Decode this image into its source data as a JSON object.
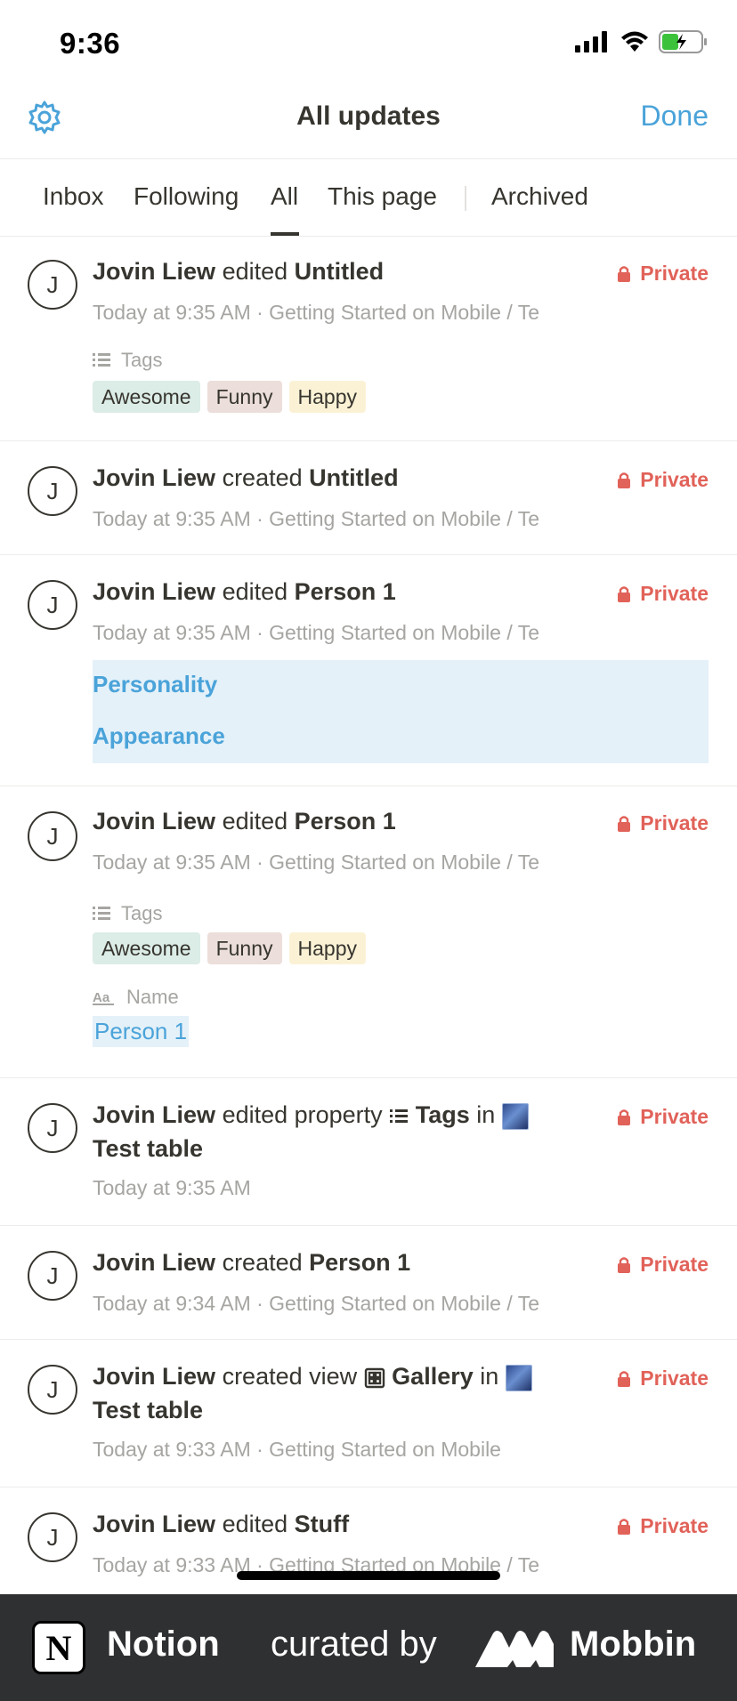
{
  "status_bar": {
    "time": "9:36"
  },
  "header": {
    "title": "All updates",
    "done_label": "Done"
  },
  "tabs": [
    {
      "label": "Inbox"
    },
    {
      "label": "Following"
    },
    {
      "label": "All"
    },
    {
      "label": "This page"
    },
    {
      "label": "Archived"
    }
  ],
  "privacy_label": "Private",
  "avatar_initial": "J",
  "items": [
    {
      "user": "Jovin Liew",
      "action": "edited",
      "target": "Untitled",
      "meta": "Today at 9:35 AM · Getting Started on Mobile / Te",
      "tags_label": "Tags",
      "tags": [
        "Awesome",
        "Funny",
        "Happy"
      ]
    },
    {
      "user": "Jovin Liew",
      "action": "created",
      "target": "Untitled",
      "meta": "Today at 9:35 AM · Getting Started on Mobile / Te"
    },
    {
      "user": "Jovin Liew",
      "action": "edited",
      "target": "Person 1",
      "meta": "Today at 9:35 AM · Getting Started on Mobile / Te",
      "highlights": [
        "Personality",
        "Appearance"
      ]
    },
    {
      "user": "Jovin Liew",
      "action": "edited",
      "target": "Person 1",
      "meta": "Today at 9:35 AM · Getting Started on Mobile / Te",
      "tags_label": "Tags",
      "tags": [
        "Awesome",
        "Funny",
        "Happy"
      ],
      "name_label": "Name",
      "name_value": "Person 1"
    },
    {
      "user": "Jovin Liew",
      "action": "edited property",
      "property": "Tags",
      "connector": "in",
      "table": "Test table",
      "meta": "Today at 9:35 AM"
    },
    {
      "user": "Jovin Liew",
      "action": "created",
      "target": "Person 1",
      "meta": "Today at 9:34 AM · Getting Started on Mobile / Te"
    },
    {
      "user": "Jovin Liew",
      "action": "created view",
      "view": "Gallery",
      "connector": "in",
      "table": "Test table",
      "meta": "Today at 9:33 AM · Getting Started on Mobile"
    },
    {
      "user": "Jovin Liew",
      "action": "edited",
      "target": "Stuff",
      "meta": "Today at 9:33 AM · Getting Started on Mobile / Te"
    }
  ],
  "banner": {
    "app_name": "Notion",
    "curated_by": "curated by",
    "brand": "Mobbin"
  },
  "colors": {
    "accent": "#4aa3d9",
    "private": "#e16259",
    "text": "#37352f",
    "muted": "#a6a5a2"
  }
}
